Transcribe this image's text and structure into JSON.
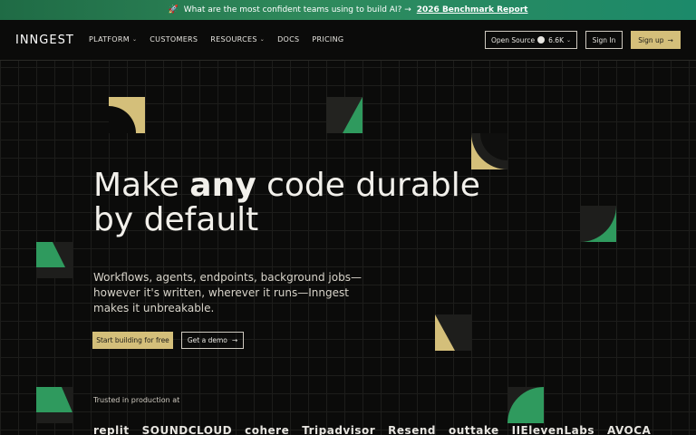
{
  "banner": {
    "icon": "rocket-icon",
    "text": "What are the most confident teams using to build AI? →",
    "link": "2026 Benchmark Report"
  },
  "nav": {
    "logo": "INNGEST",
    "items": [
      {
        "label": "PLATFORM",
        "dropdown": true
      },
      {
        "label": "CUSTOMERS",
        "dropdown": false
      },
      {
        "label": "RESOURCES",
        "dropdown": true
      },
      {
        "label": "DOCS",
        "dropdown": false
      },
      {
        "label": "PRICING",
        "dropdown": false
      }
    ],
    "open_source": "Open Source",
    "stars": "6.6K",
    "sign_in": "Sign In",
    "sign_up": "Sign up",
    "arrow": "→",
    "chevron": "⌄"
  },
  "hero": {
    "title_before": "Make ",
    "title_emphasis": "any",
    "title_after": " code durable by default",
    "subtitle": "Workflows, agents, endpoints, background jobs—however it's written, wherever it runs—Inngest makes it unbreakable.",
    "cta_primary": "Start building for free",
    "cta_secondary": "Get a demo",
    "cta_arrow": "→"
  },
  "trusted": {
    "label": "Trusted in production at",
    "logos": [
      "replit",
      "SOUNDCLOUD",
      "cohere",
      "Tripadvisor",
      "Resend",
      "outtake",
      "IIElevenLabs",
      "AVOCA"
    ]
  },
  "colors": {
    "gold": "#d4bf7a",
    "green": "#2f9a5e",
    "dark_tile": "#232320",
    "banner": "#2f8a5c"
  }
}
